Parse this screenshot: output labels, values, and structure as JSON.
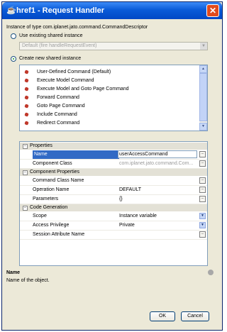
{
  "window": {
    "title": "href1 - Request Handler",
    "close_glyph": "✕"
  },
  "instance_label": "Instance of type com.iplanet.jato.command.CommandDescriptor",
  "options": {
    "use_existing": "Use existing shared instance",
    "combo_value": "Default (fire handleRequestEvent)",
    "create_new": "Create new shared instance"
  },
  "command_list": [
    "User-Defined Command (Default)",
    "Execute Model Command",
    "Execute Model and Goto Page Command",
    "Forward Command",
    "Goto Page Command",
    "Include Command",
    "Redirect Command"
  ],
  "properties": {
    "sections": {
      "properties": "Properties",
      "component_properties": "Component Properties",
      "code_generation": "Code Generation"
    },
    "rows": {
      "name": {
        "label": "Name",
        "value": "userAccessCommand"
      },
      "component_class": {
        "label": "Component Class",
        "value": "com.iplanet.jato.command.Com..."
      },
      "command_class_name": {
        "label": "Command Class Name",
        "value": ""
      },
      "operation_name": {
        "label": "Operation Name",
        "value": "DEFAULT"
      },
      "parameters": {
        "label": "Parameters",
        "value": "{}"
      },
      "scope": {
        "label": "Scope",
        "value": "Instance variable"
      },
      "access_privilege": {
        "label": "Access Privilege",
        "value": "Private"
      },
      "session_attribute_name": {
        "label": "Session Attribute Name",
        "value": ""
      }
    }
  },
  "description": {
    "title": "Name",
    "text": "Name of the object."
  },
  "buttons": {
    "ok": "OK",
    "cancel": "Cancel"
  },
  "glyphs": {
    "ellipsis": "...",
    "dropdown": "▼",
    "collapse": "−",
    "up": "▲",
    "down": "▼"
  },
  "colors": {
    "title_bar": "#0a5bd8",
    "selection": "#316ac5",
    "bean": "#c0392b"
  }
}
